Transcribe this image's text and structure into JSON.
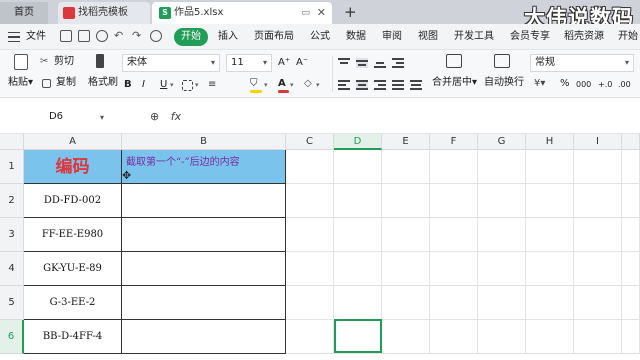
{
  "tabs": {
    "home": "首页",
    "template": "找稻壳模板",
    "document": "作品5.xlsx",
    "new_tab": "+"
  },
  "watermark": "大伟说数码",
  "menu": {
    "file": "文件",
    "start": "开始",
    "insert": "插入",
    "page_layout": "页面布局",
    "formula": "公式",
    "data": "数据",
    "review": "审阅",
    "view": "视图",
    "dev_tools": "开发工具",
    "member": "会员专享",
    "resources": "稻壳资源",
    "more": "开始"
  },
  "ribbon": {
    "cut": "剪切",
    "paste": "粘贴",
    "copy": "复制",
    "format_painter": "格式刷",
    "font": "宋体",
    "font_size": "11",
    "merge": "合并居中",
    "wrap": "自动换行",
    "number_format": "常规",
    "percent": "%",
    "thousands": "000",
    "dec_inc": "+.0",
    "dec_dec": ".00"
  },
  "formula_bar": {
    "cell_ref": "D6",
    "fx": "fx",
    "content": ""
  },
  "columns": [
    "A",
    "B",
    "C",
    "D",
    "E",
    "F",
    "G",
    "H",
    "I"
  ],
  "active_column": "D",
  "rows": [
    "1",
    "2",
    "3",
    "4",
    "5",
    "6"
  ],
  "active_row": "6",
  "sheet": {
    "header_a": "编码",
    "header_b": "截取第一个“-”后边的内容",
    "codes": [
      "DD-FD-002",
      "FF-EE-E980",
      "GK-YU-E-89",
      "G-3-EE-2",
      "BB-D-4FF-4"
    ]
  },
  "colors": {
    "accent": "#1f9e55",
    "header_fill": "#7ac3ec",
    "header_a_text": "#e0353a",
    "header_b_text": "#7a2ca0"
  }
}
